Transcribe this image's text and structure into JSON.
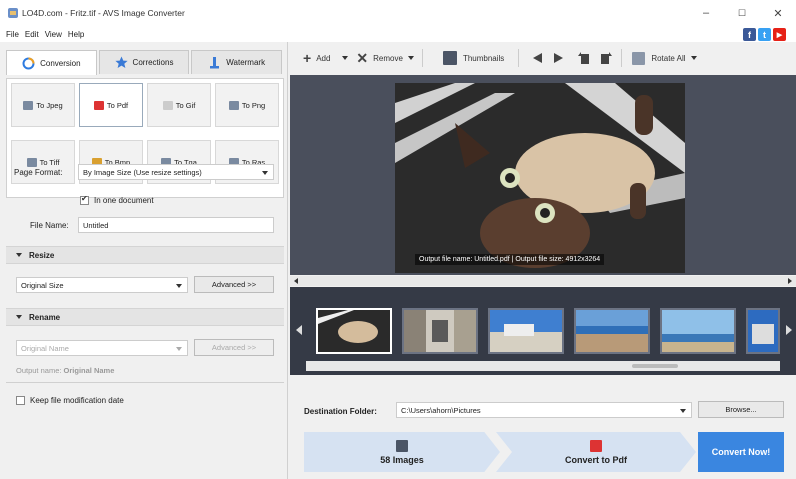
{
  "window": {
    "title": "LO4D.com - Fritz.tif - AVS Image Converter",
    "controls": {
      "minimize": "–",
      "maximize": "☐",
      "close": "✕"
    }
  },
  "menu": [
    "File",
    "Edit",
    "View",
    "Help"
  ],
  "social": [
    {
      "icon": "facebook-icon",
      "letter": "f",
      "color": "#3b5998"
    },
    {
      "icon": "twitter-icon",
      "letter": "t",
      "color": "#38a1f3"
    },
    {
      "icon": "youtube-icon",
      "letter": "▶",
      "color": "#e62117"
    }
  ],
  "tabs": [
    {
      "label": "Conversion",
      "icon": "conversion-icon",
      "active": true
    },
    {
      "label": "Corrections",
      "icon": "star-icon",
      "active": false
    },
    {
      "label": "Watermark",
      "icon": "watermark-icon",
      "active": false
    }
  ],
  "formats": [
    {
      "label": "To Jpeg",
      "selected": false
    },
    {
      "label": "To Pdf",
      "selected": true
    },
    {
      "label": "To Gif",
      "selected": false
    },
    {
      "label": "To Png",
      "selected": false
    },
    {
      "label": "To Tiff",
      "selected": false
    },
    {
      "label": "To Bmp",
      "selected": false
    },
    {
      "label": "To Tga",
      "selected": false
    },
    {
      "label": "To Ras",
      "selected": false
    }
  ],
  "options": {
    "page_format_label": "Page Format:",
    "page_format_value": "By Image Size (Use resize settings)",
    "one_document_label": "In one document",
    "file_name_label": "File Name:",
    "file_name_value": "Untitled"
  },
  "resize": {
    "header": "Resize",
    "value": "Original Size",
    "advanced": "Advanced >>"
  },
  "rename": {
    "header": "Rename",
    "value": "Original Name",
    "advanced": "Advanced >>",
    "output_label": "Output name:",
    "output_value": "Original Name"
  },
  "keep_date_label": "Keep file modification date",
  "toolbar": {
    "add": "Add",
    "remove": "Remove",
    "thumbnails": "Thumbnails",
    "rotate_all": "Rotate All"
  },
  "preview": {
    "caption": "Output file name: Untitled.pdf | Output file size: 4912x3264"
  },
  "thumbnails_count": 6,
  "destination": {
    "label": "Destination Folder:",
    "value": "C:\\Users\\ahorn\\Pictures",
    "browse": "Browse..."
  },
  "steps": {
    "images": "58 Images",
    "convert_to": "Convert to Pdf",
    "convert_now": "Convert Now!"
  }
}
